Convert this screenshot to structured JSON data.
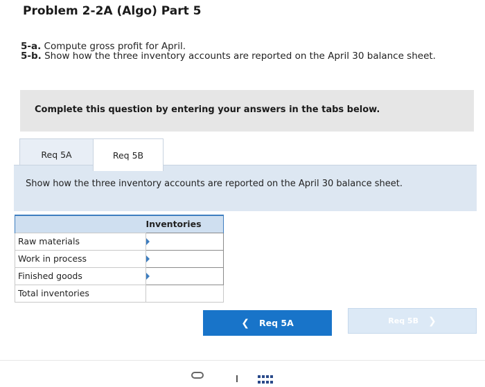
{
  "title": "Problem 2-2A (Algo) Part 5",
  "instructions": {
    "part_a_label": "5-a.",
    "part_a_text": " Compute gross profit for April.",
    "part_b_label": "5-b.",
    "part_b_text": " Show how the three inventory accounts are reported on the April 30 balance sheet."
  },
  "banner": "Complete this question by entering your answers in the tabs below.",
  "tabs": [
    {
      "label": "Req 5A",
      "active": false
    },
    {
      "label": "Req 5B",
      "active": true
    }
  ],
  "panel_text": "Show how the three inventory accounts are reported on the April 30 balance sheet.",
  "table": {
    "column_header": "Inventories",
    "rows": [
      {
        "label": "Raw materials",
        "value": ""
      },
      {
        "label": "Work in process",
        "value": ""
      },
      {
        "label": "Finished goods",
        "value": ""
      },
      {
        "label": "Total inventories",
        "value": ""
      }
    ]
  },
  "nav": {
    "prev_label": "Req 5A",
    "next_label": "Req 5B"
  },
  "colors": {
    "primary_button": "#1874c9",
    "disabled_button": "#dce9f6",
    "table_header": "#cfdff0",
    "panel": "#dde7f2",
    "banner": "#e6e6e6"
  }
}
